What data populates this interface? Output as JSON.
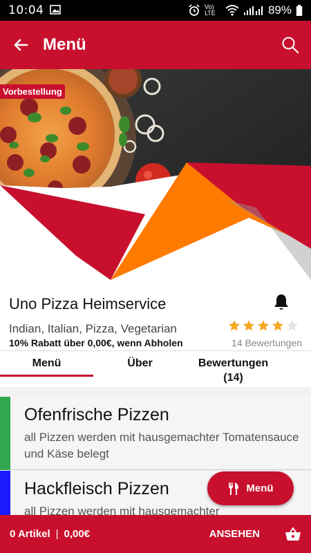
{
  "status_bar": {
    "time": "10:04",
    "network_label": "Vo) LTE",
    "battery": "89%"
  },
  "app_bar": {
    "title": "Menü",
    "back_icon": "arrow-left-icon",
    "search_icon": "search-icon"
  },
  "hero": {
    "badge": "Vorbestellung",
    "image": "pizza-banner"
  },
  "restaurant": {
    "name": "Uno Pizza Heimservice",
    "cuisines": "Indian, Italian, Pizza, Vegetarian",
    "discount": "10% Rabatt über 0,00€, wenn Abholen",
    "rating": 4,
    "rating_max": 5,
    "reviews": "14 Bewertungen"
  },
  "tabs": [
    {
      "label": "Menü",
      "active": true
    },
    {
      "label": "Über",
      "active": false
    },
    {
      "label": "Bewertungen\n(14)",
      "active": false
    }
  ],
  "categories": [
    {
      "title": "Ofenfrische Pizzen",
      "description": "all Pizzen werden mit hausgemachter Tomatensauce und Käse belegt",
      "color": "#2fa84f"
    },
    {
      "title": "Hackfleisch Pizzen",
      "description": "all Pizzen werden mit hausgemachter",
      "color": "#1a1aff"
    }
  ],
  "fab": {
    "label": "Menü",
    "icon": "cutlery-icon"
  },
  "cart_bar": {
    "items": "0 Artikel",
    "separator": "|",
    "total": "0,00€",
    "view_label": "ANSEHEN",
    "cart_icon": "basket-icon"
  },
  "colors": {
    "primary": "#c8102e",
    "accent_orange": "#ff7a00",
    "star": "#f5a623"
  }
}
